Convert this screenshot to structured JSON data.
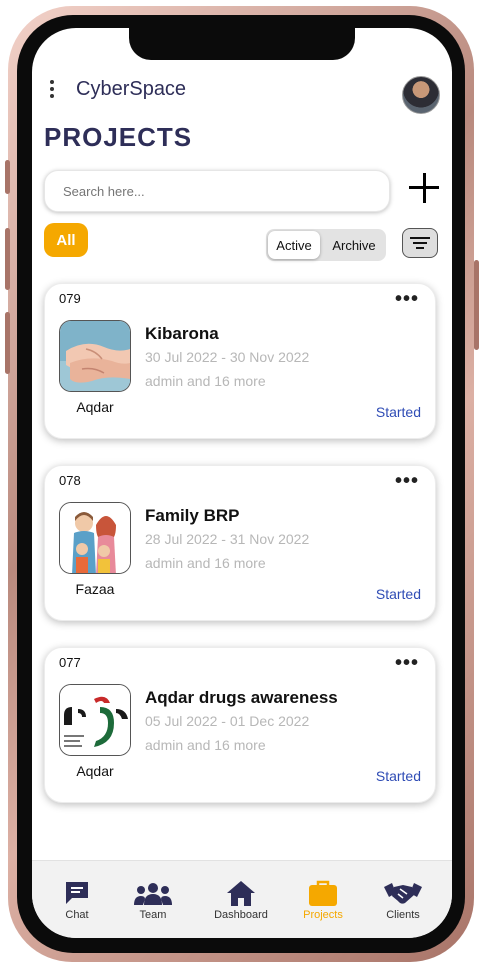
{
  "app": {
    "title": "CyberSpace"
  },
  "page": {
    "title": "PROJECTS"
  },
  "search": {
    "placeholder": "Search here..."
  },
  "filters": {
    "all_label": "All",
    "active_label": "Active",
    "archive_label": "Archive",
    "selected": "Active"
  },
  "projects": [
    {
      "id": "079",
      "title": "Kibarona",
      "dates": "30 Jul 2022 - 30 Nov 2022",
      "members": "admin and 16 more",
      "org": "Aqdar",
      "status": "Started",
      "thumb_icon": "elderly-hands-photo"
    },
    {
      "id": "078",
      "title": "Family BRP",
      "dates": "28 Jul 2022 - 31 Nov 2022",
      "members": "admin and 16 more",
      "org": "Fazaa",
      "status": "Started",
      "thumb_icon": "family-illustration"
    },
    {
      "id": "077",
      "title": "Aqdar drugs awareness",
      "dates": "05 Jul 2022 - 01 Dec  2022",
      "members": "admin and 16 more",
      "org": "Aqdar",
      "status": "Started",
      "thumb_icon": "aqdar-logo"
    }
  ],
  "nav": {
    "items": [
      {
        "label": "Chat",
        "icon": "chat-icon"
      },
      {
        "label": "Team",
        "icon": "team-icon"
      },
      {
        "label": "Dashboard",
        "icon": "home-icon"
      },
      {
        "label": "Projects",
        "icon": "briefcase-icon"
      },
      {
        "label": "Clients",
        "icon": "handshake-icon"
      }
    ],
    "active": "Projects"
  },
  "colors": {
    "accent": "#f5a800",
    "title": "#2e2e58",
    "status": "#2f4cb5",
    "muted": "#b7b7b7"
  }
}
